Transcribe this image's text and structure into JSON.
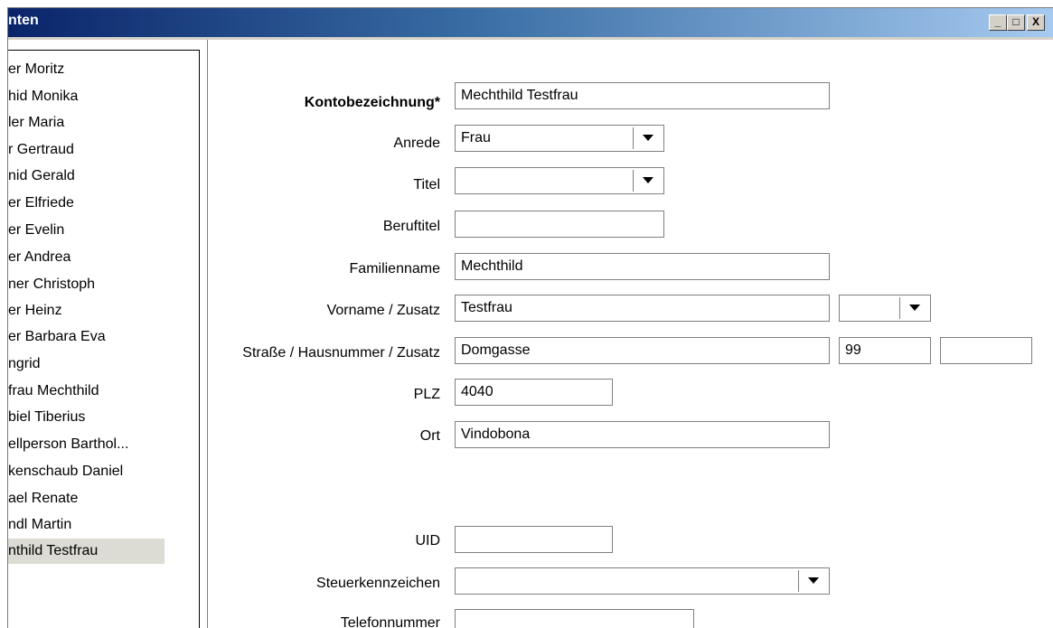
{
  "window": {
    "title": "nten",
    "buttons": {
      "minimize": "_",
      "maximize": "□",
      "close": "X"
    }
  },
  "list": {
    "items": [
      {
        "label": "er Moritz"
      },
      {
        "label": "hid Monika"
      },
      {
        "label": "ler Maria"
      },
      {
        "label": "r Gertraud"
      },
      {
        "label": "nid Gerald"
      },
      {
        "label": "er Elfriede"
      },
      {
        "label": "er Evelin"
      },
      {
        "label": "er Andrea"
      },
      {
        "label": "ner Christoph"
      },
      {
        "label": "er Heinz"
      },
      {
        "label": "er Barbara Eva"
      },
      {
        "label": "ngrid"
      },
      {
        "label": "frau Mechthild"
      },
      {
        "label": "biel Tiberius"
      },
      {
        "label": "ellperson Barthol..."
      },
      {
        "label": "kenschaub Daniel"
      },
      {
        "label": "ael Renate"
      },
      {
        "label": "ndl Martin"
      },
      {
        "label": "nthild Testfrau",
        "selected": true
      }
    ]
  },
  "form": {
    "kontobezeichnung": {
      "label": "Kontobezeichnung*",
      "value": "Mechthild Testfrau"
    },
    "anrede": {
      "label": "Anrede",
      "value": "Frau"
    },
    "titel": {
      "label": "Titel",
      "value": ""
    },
    "beruftitel": {
      "label": "Beruftitel",
      "value": ""
    },
    "familienname": {
      "label": "Familienname",
      "value": "Mechthild"
    },
    "vorname": {
      "label": "Vorname / Zusatz",
      "value": "Testfrau",
      "zusatz": ""
    },
    "strasse": {
      "label": "Straße / Hausnummer / Zusatz",
      "value": "Domgasse",
      "hausnummer": "99",
      "zusatz": ""
    },
    "plz": {
      "label": "PLZ",
      "value": "4040"
    },
    "ort": {
      "label": "Ort",
      "value": "Vindobona"
    },
    "uid": {
      "label": "UID",
      "value": ""
    },
    "steuerkennzeichen": {
      "label": "Steuerkennzeichen",
      "value": ""
    },
    "telefonnummer": {
      "label": "Telefonnummer",
      "value": ""
    }
  },
  "icons": {
    "dropdown": "chevron-down-icon"
  }
}
